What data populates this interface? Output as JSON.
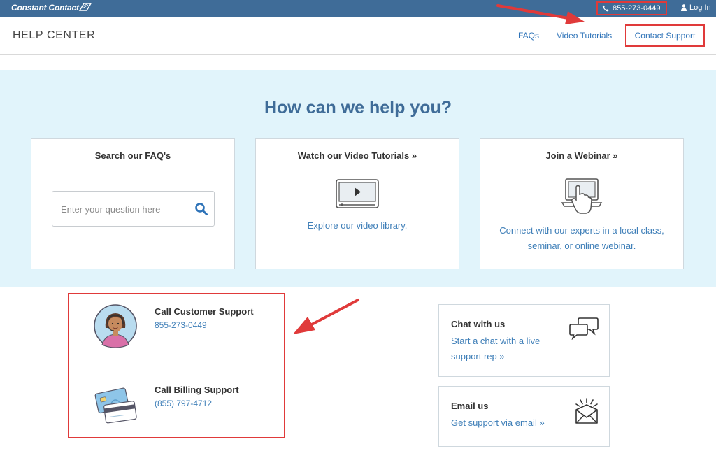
{
  "topbar": {
    "logo": "Constant Contact",
    "logo_mark_icon": "constant-contact-flag-icon",
    "phone": "855-273-0449",
    "phone_icon": "phone-icon",
    "login_label": "Log In",
    "login_icon": "user-icon"
  },
  "header": {
    "title": "HELP CENTER",
    "nav": {
      "faqs": "FAQs",
      "video_tutorials": "Video Tutorials",
      "contact_support": "Contact Support"
    }
  },
  "hero": {
    "title": "How can we help you?",
    "cards": [
      {
        "title": "Search our FAQ's",
        "placeholder": "Enter your question here",
        "icon": "search-icon"
      },
      {
        "title": "Watch our Video Tutorials »",
        "description": "Explore our video library.",
        "icon": "video-player-icon"
      },
      {
        "title": "Join a Webinar »",
        "description_line1": "Connect with our experts in a local class,",
        "description_line2": "seminar, or online webinar.",
        "icon": "laptop-touch-icon"
      }
    ]
  },
  "support": {
    "customer": {
      "title": "Call Customer Support",
      "phone": "855-273-0449",
      "icon": "support-agent-avatar-icon"
    },
    "billing": {
      "title": "Call Billing Support",
      "phone": "(855) 797-4712",
      "icon": "credit-cards-icon"
    }
  },
  "side": {
    "chat": {
      "title": "Chat with us",
      "line1": "Start a chat with a live",
      "line2": "support rep »",
      "icon": "chat-bubbles-icon"
    },
    "email": {
      "title": "Email us",
      "description": "Get support via email »",
      "icon": "envelope-icon"
    }
  },
  "colors": {
    "topbar": "#3f6c98",
    "hero_bg": "#e1f4fb",
    "link": "#3f7fb8",
    "annotation": "#e03a3a"
  }
}
